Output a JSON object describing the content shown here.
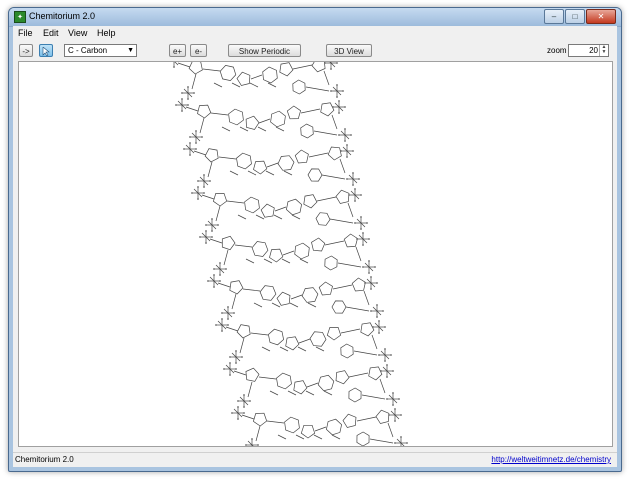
{
  "window": {
    "title": "Chemitorium 2.0",
    "min_glyph": "–",
    "max_glyph": "□",
    "close_glyph": "✕",
    "icon": "app-icon"
  },
  "menu": {
    "items": [
      "File",
      "Edit",
      "View",
      "Help"
    ]
  },
  "toolbar": {
    "arrow_button": "->",
    "pointer_button_icon": "pointer-icon",
    "element_select": "C - Carbon",
    "electron_add": "e+",
    "electron_remove": "e-",
    "periodic_button": "Show Periodic System",
    "view3d_button": "3D View",
    "zoom_label": "zoom",
    "zoom_value": "20"
  },
  "status": {
    "left": "Chemitorium 2.0",
    "link": "http://weltweitimnetz.de/chemistry"
  }
}
